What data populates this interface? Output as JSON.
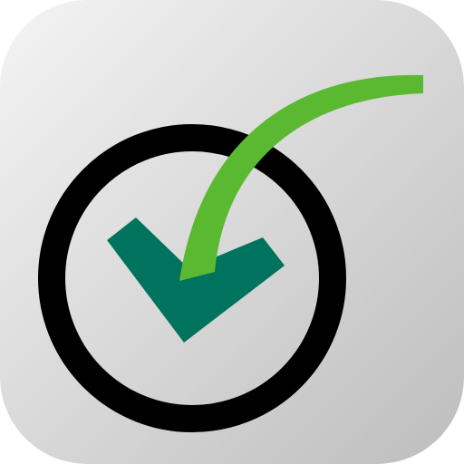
{
  "app_icon": {
    "icon": "checkmark-in-circle-icon",
    "colors": {
      "background_light": "#f4f4f4",
      "background_dark": "#bdbdbd",
      "ring": "#000000",
      "checkmark_dark_green": "#00735e",
      "swoosh_green": "#5bb931"
    }
  }
}
